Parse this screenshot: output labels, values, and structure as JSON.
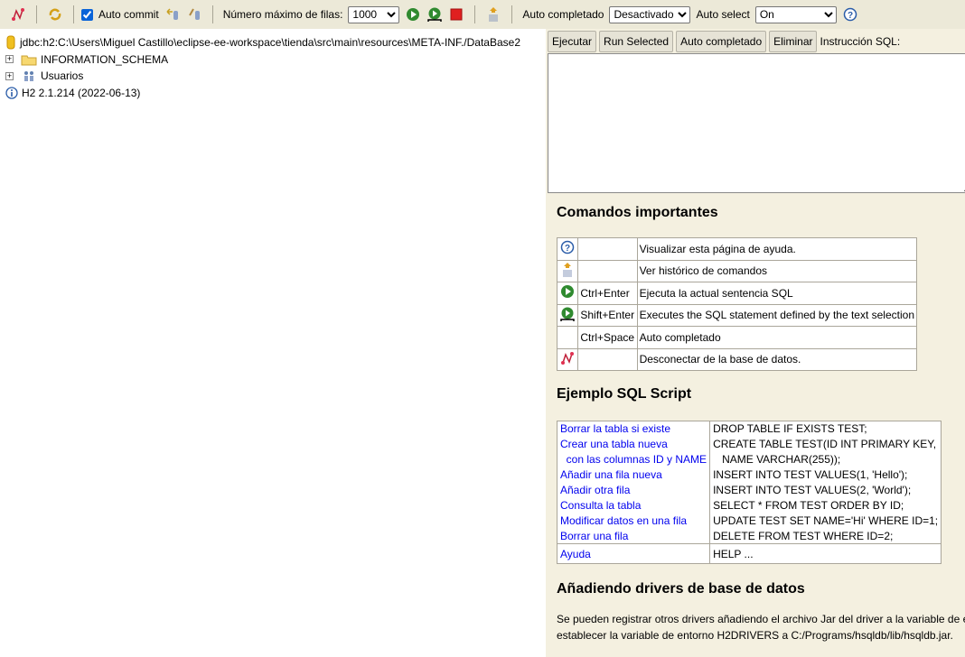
{
  "toolbar": {
    "auto_commit_label": "Auto commit",
    "auto_commit_checked": true,
    "max_rows_label": "Número máximo de filas:",
    "max_rows_value": "1000",
    "autocomplete_label": "Auto completado",
    "autocomplete_value": "Desactivado",
    "autoselect_label": "Auto select",
    "autoselect_value": "On",
    "icons": [
      "disconnect-icon",
      "refresh-icon",
      "rollback-icon",
      "commit-icon",
      "run-icon",
      "run-selected-icon",
      "stop-icon",
      "history-icon",
      "help-icon"
    ]
  },
  "tree": {
    "connection": "jdbc:h2:C:\\Users\\Miguel Castillo\\eclipse-ee-workspace\\tienda\\src\\main\\resources\\META-INF./DataBase2",
    "items": [
      "INFORMATION_SCHEMA",
      "Usuarios"
    ],
    "version": "H2 2.1.214 (2022-06-13)"
  },
  "sql_panel": {
    "buttons": [
      "Ejecutar",
      "Run Selected",
      "Auto completado",
      "Eliminar"
    ],
    "label": "Instrucción SQL:",
    "value": ""
  },
  "help": {
    "commands_title": "Comandos importantes",
    "commands": [
      {
        "icon": "help-icon",
        "key": "",
        "desc": "Visualizar esta página de ayuda."
      },
      {
        "icon": "history-icon",
        "key": "",
        "desc": "Ver histórico de comandos"
      },
      {
        "icon": "run-icon",
        "key": "Ctrl+Enter",
        "desc": "Ejecuta la actual sentencia SQL"
      },
      {
        "icon": "run-selected-icon",
        "key": "Shift+Enter",
        "desc": "Executes the SQL statement defined by the text selection"
      },
      {
        "icon": "",
        "key": "Ctrl+Space",
        "desc": "Auto completado"
      },
      {
        "icon": "disconnect-icon",
        "key": "",
        "desc": "Desconectar de la base de datos."
      }
    ],
    "example_title": "Ejemplo SQL Script",
    "examples": [
      {
        "label": "Borrar la tabla si existe",
        "sql": "DROP TABLE IF EXISTS TEST;"
      },
      {
        "label": "Crear una tabla nueva",
        "sql": "CREATE TABLE TEST(ID INT PRIMARY KEY,"
      },
      {
        "label": "  con las columnas ID y NAME",
        "sql": "   NAME VARCHAR(255));"
      },
      {
        "label": "Añadir una fila nueva",
        "sql": "INSERT INTO TEST VALUES(1, 'Hello');"
      },
      {
        "label": "Añadir otra fila",
        "sql": "INSERT INTO TEST VALUES(2, 'World');"
      },
      {
        "label": "Consulta la tabla",
        "sql": "SELECT * FROM TEST ORDER BY ID;"
      },
      {
        "label": "Modificar datos en una fila",
        "sql": "UPDATE TEST SET NAME='Hi' WHERE ID=1;"
      },
      {
        "label": "Borrar una fila",
        "sql": "DELETE FROM TEST WHERE ID=2;"
      },
      {
        "label": "Ayuda",
        "sql": "HELP ..."
      }
    ],
    "drivers_title": "Añadiendo drivers de base de datos",
    "drivers_text_1": "Se pueden registrar otros drivers añadiendo el archivo Jar del driver a la variable de e",
    "drivers_text_2": "establecer la variable de entorno H2DRIVERS a C:/Programs/hsqldb/lib/hsqldb.jar."
  }
}
